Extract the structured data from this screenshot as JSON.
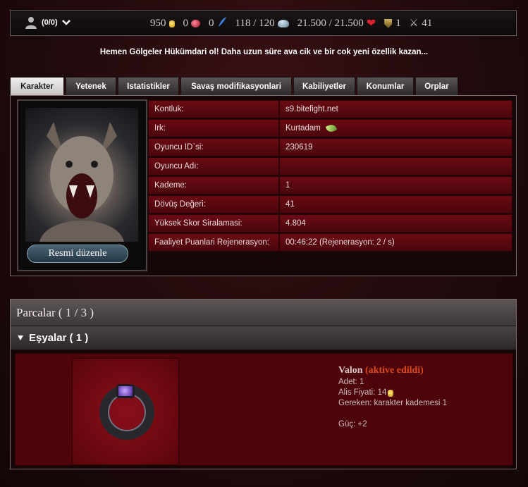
{
  "header": {
    "user": {
      "label": "(0/0)"
    },
    "stats": [
      {
        "value": "950",
        "icon": "gold-coin-icon"
      },
      {
        "value": "0",
        "icon": "gem-icon"
      },
      {
        "value": "0",
        "icon": "feather-icon"
      },
      {
        "value": "118 / 120",
        "icon": "cloud-icon"
      },
      {
        "value": "21.500 / 21.500",
        "icon": "heart-icon"
      },
      {
        "value": "1",
        "icon": "shield-icon"
      },
      {
        "value": "41",
        "icon": "crossed-swords-icon"
      }
    ]
  },
  "promo": "Hemen Gölgeler Hükümdari ol! Daha uzun süre ava cik ve bir cok yeni özellik kazan...",
  "tabs": [
    "Karakter",
    "Yetenek",
    "Istatistikler",
    "Savaş modifikasyonlari",
    "Kabiliyetler",
    "Konumlar",
    "Orplar"
  ],
  "activeTab": "Karakter",
  "portrait": {
    "edit_label": "Resmi düzenle"
  },
  "character_info": [
    {
      "key": "Kontluk:",
      "value": "s9.bitefight.net"
    },
    {
      "key": "Irk:",
      "value": "Kurtadam"
    },
    {
      "key": "Oyuncu ID`si:",
      "value": "230619"
    },
    {
      "key": "Oyuncu Adı:",
      "value": ""
    },
    {
      "key": "Kademe:",
      "value": "1"
    },
    {
      "key": "Dövüş Değeri:",
      "value": "41"
    },
    {
      "key": "Yüksek Skor Siralamasi:",
      "value": "4.804"
    },
    {
      "key": "Faaliyet Puanlari Rejenerasyon:",
      "value": "00:46:22 (Rejenerasyon: 2 / s)"
    }
  ],
  "parts": {
    "title": "Parcalar ( 1 / 3 )",
    "items_header": "Eşyalar ( 1 )",
    "item": {
      "name": "Valon",
      "status": "(aktive edildi)",
      "quantity": "Adet: 1",
      "price": "Alis Fiyati: 14",
      "requirement": "Gereken: karakter kademesi 1",
      "bonus": "Güç: +2"
    }
  },
  "colors": {
    "accent_red": "#6b0a13",
    "active_text": "#e04a1a"
  }
}
